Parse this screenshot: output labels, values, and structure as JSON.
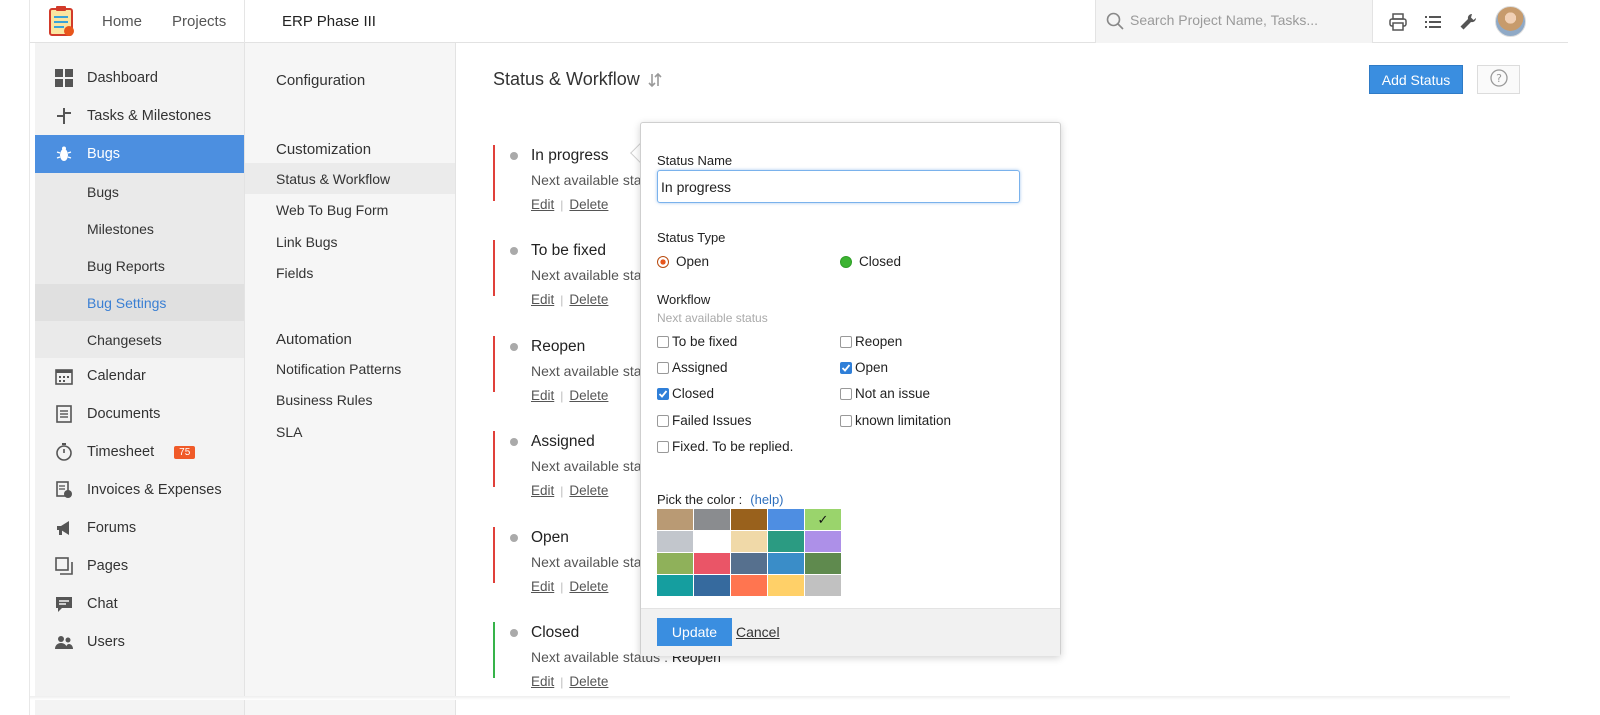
{
  "topbar": {
    "nav": [
      "Home",
      "Projects"
    ],
    "project_title": "ERP Phase III",
    "search_placeholder": "Search Project Name, Tasks..."
  },
  "sidebar": {
    "items": [
      {
        "label": "Dashboard",
        "icon": "dashboard-icon"
      },
      {
        "label": "Tasks & Milestones",
        "icon": "tasks-icon"
      },
      {
        "label": "Bugs",
        "icon": "bug-icon"
      },
      {
        "label": "Calendar",
        "icon": "calendar-icon"
      },
      {
        "label": "Documents",
        "icon": "documents-icon"
      },
      {
        "label": "Timesheet",
        "icon": "timer-icon",
        "badge": "75"
      },
      {
        "label": "Invoices & Expenses",
        "icon": "invoice-icon"
      },
      {
        "label": "Forums",
        "icon": "megaphone-icon"
      },
      {
        "label": "Pages",
        "icon": "pages-icon"
      },
      {
        "label": "Chat",
        "icon": "chat-icon"
      },
      {
        "label": "Users",
        "icon": "users-icon"
      }
    ],
    "bug_sub": [
      "Bugs",
      "Milestones",
      "Bug Reports",
      "Bug Settings",
      "Changesets"
    ]
  },
  "config": {
    "title": "Configuration",
    "customization_heading": "Customization",
    "customization_items": [
      "Status & Workflow",
      "Web To Bug Form",
      "Link Bugs",
      "Fields"
    ],
    "automation_heading": "Automation",
    "automation_items": [
      "Notification Patterns",
      "Business Rules",
      "SLA"
    ]
  },
  "main": {
    "title": "Status & Workflow",
    "add_status": "Add Status",
    "statuses": [
      {
        "name": "In progress",
        "next_prefix": "Next available sta",
        "next_value": ""
      },
      {
        "name": "To be fixed",
        "next_prefix": "Next available sta",
        "next_value": ""
      },
      {
        "name": "Reopen",
        "next_prefix": "Next available sta",
        "next_value": ""
      },
      {
        "name": "Assigned",
        "next_prefix": "Next available sta",
        "next_value": ""
      },
      {
        "name": "Open",
        "next_prefix": "Next available sta",
        "next_value": ""
      },
      {
        "name": "Closed",
        "next_prefix": "Next available status :",
        "next_value": "Reopen"
      }
    ],
    "edit_label": "Edit",
    "delete_label": "Delete",
    "pipe": "|"
  },
  "popup": {
    "status_name_label": "Status Name",
    "status_name_value": "In progress",
    "status_type_label": "Status Type",
    "type_open": "Open",
    "type_closed": "Closed",
    "workflow_label": "Workflow",
    "workflow_hint": "Next available status",
    "options": [
      {
        "label": "To be fixed",
        "checked": false
      },
      {
        "label": "Reopen",
        "checked": false
      },
      {
        "label": "Assigned",
        "checked": false
      },
      {
        "label": "Open",
        "checked": true
      },
      {
        "label": "Closed",
        "checked": true
      },
      {
        "label": "Not an issue",
        "checked": false
      },
      {
        "label": "Failed Issues",
        "checked": false
      },
      {
        "label": "known limitation",
        "checked": false
      },
      {
        "label": "Fixed. To be replied.",
        "checked": false
      }
    ],
    "pick_color_label": "Pick the color :",
    "help_label": "(help)",
    "selected_mark": "✓",
    "palette": [
      "#b99a74",
      "#8a8c8f",
      "#99611c",
      "#4e8ee2",
      "#9ad46c",
      "#c2c6cc",
      "#ffffff",
      "#f0d9a8",
      "#2b9b82",
      "#ad90e8",
      "#8fb15a",
      "#ea5567",
      "#56708e",
      "#3a8dc8",
      "#5f8a4e",
      "#159e9f",
      "#366a9e",
      "#ff7550",
      "#ffd068",
      "#c1c1c1"
    ],
    "update": "Update",
    "cancel": "Cancel"
  },
  "colors": {
    "accent": "#3a8ee0",
    "active_sidebar": "#4c8fe0",
    "status_bar_red": "#e0403a",
    "status_bar_green": "#36b34a",
    "badge": "#f05a28"
  }
}
